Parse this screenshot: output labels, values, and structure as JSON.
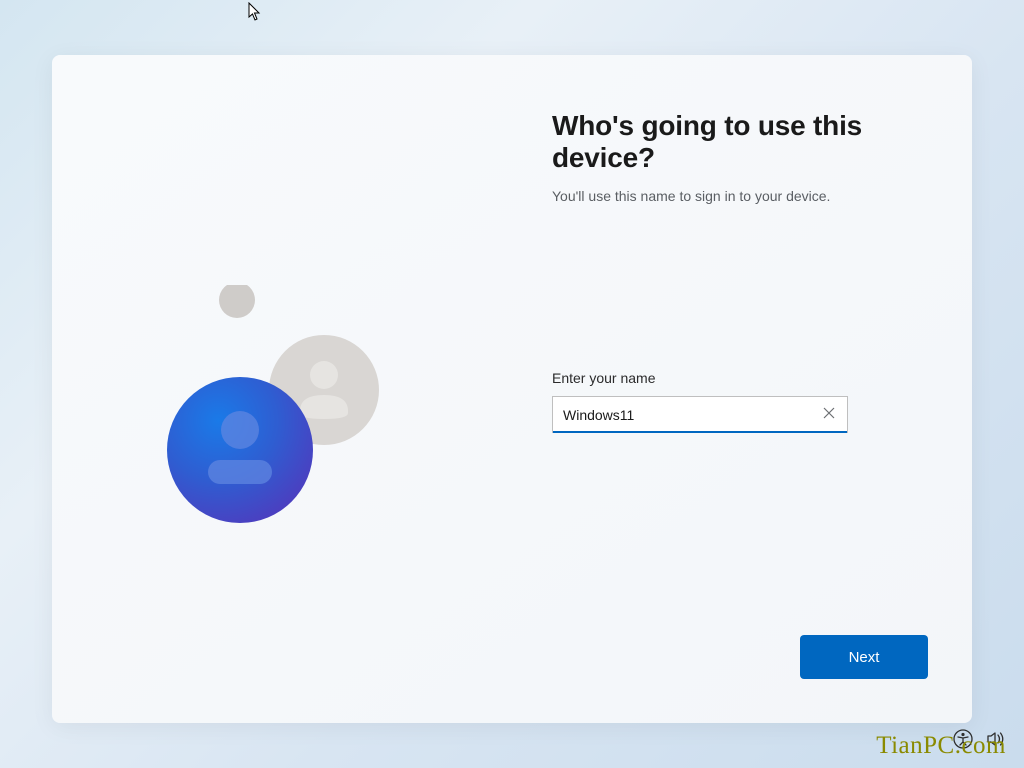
{
  "setup": {
    "heading": "Who's going to use this device?",
    "subheading": "You'll use this name to sign in to your device.",
    "name_field_label": "Enter your name",
    "name_field_value": "Windows11",
    "name_field_placeholder": "",
    "next_button_label": "Next"
  },
  "colors": {
    "accent": "#0067c0",
    "user_circle_large": "#2f5dd1",
    "user_circle_mid": "#d9d6d3",
    "user_circle_small": "#cfccc9"
  },
  "watermark_text": "TianPC.com"
}
